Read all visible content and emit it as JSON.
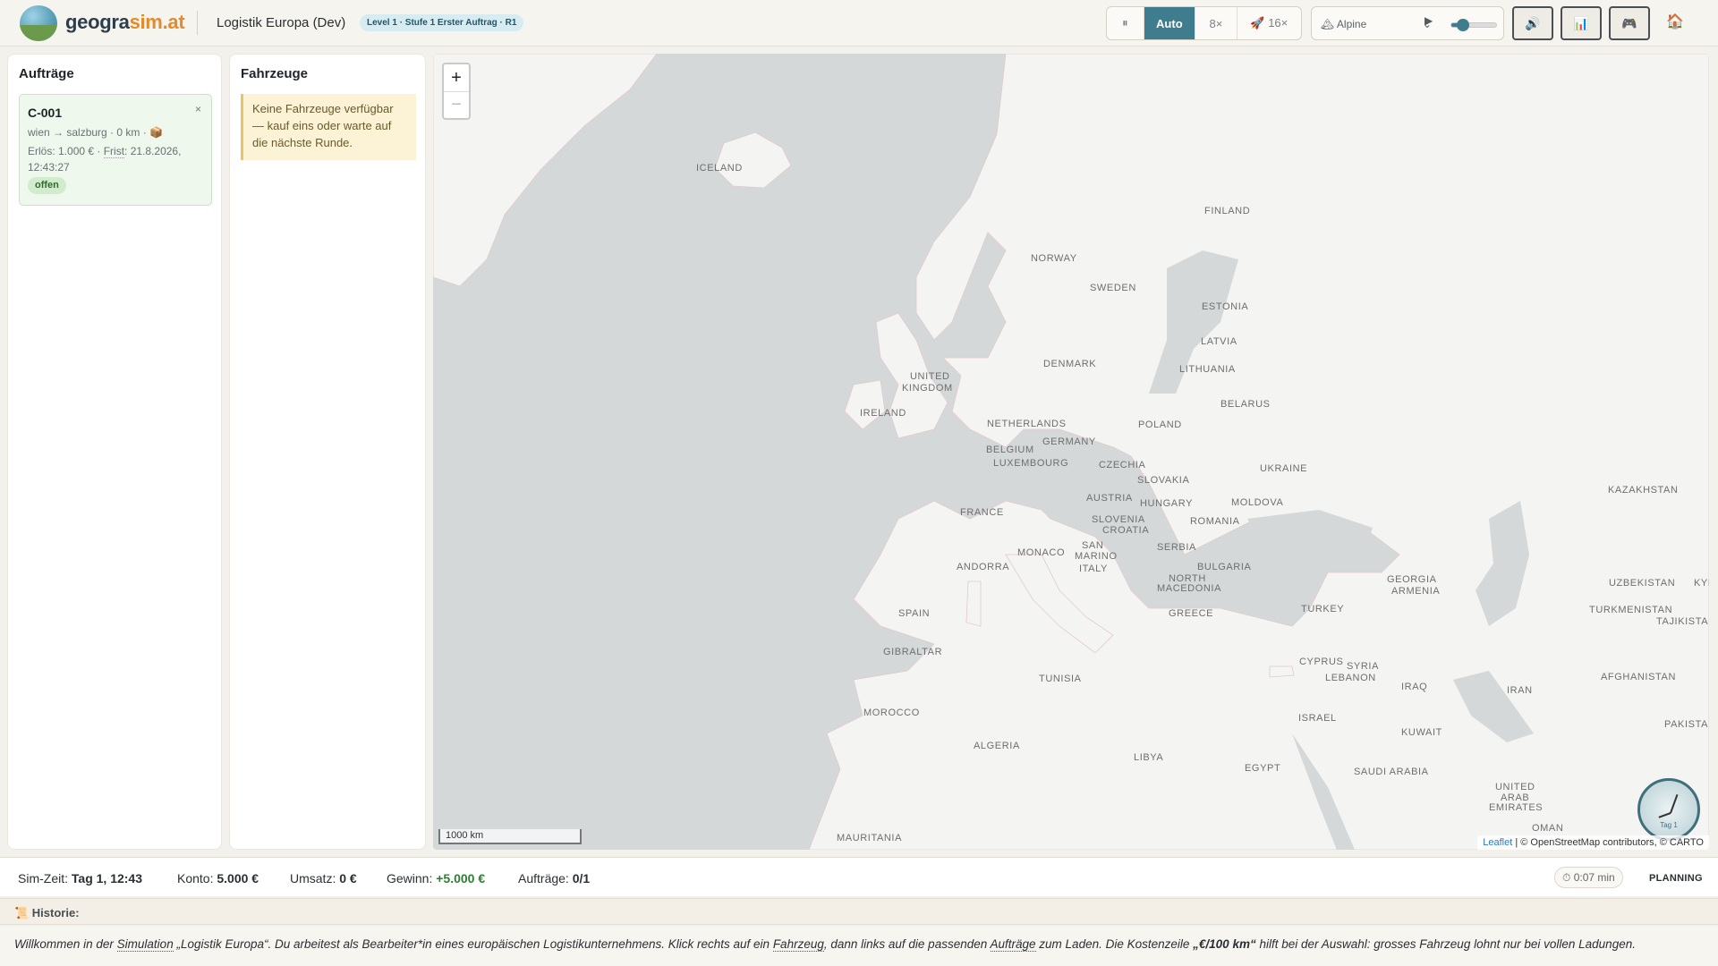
{
  "header": {
    "brand_main": "geogra",
    "brand_accent": "sim.at",
    "game_title": "Logistik Europa (Dev)",
    "level_pill": "Level 1 · Stufe 1 Erster Auftrag · R1",
    "speed": {
      "pause_label": "⏸",
      "auto_label": "Auto",
      "x8_label": "8×",
      "x16_label": "🚀 16×",
      "active": "Auto"
    },
    "music": {
      "track_label": "🏔 Alpine",
      "chevron": "⌄",
      "play_label": "▶",
      "volume": 0.25
    },
    "sound_icon": "🔊",
    "stats_icon": "📊",
    "gamepad_icon": "🎮",
    "home_icon": "🏠"
  },
  "orders_panel": {
    "title": "Aufträge",
    "orders": [
      {
        "id": "C-001",
        "close": "×",
        "route": "wien → salzburg · 0 km · 📦",
        "revenue_prefix": "Erlös: 1.000 € · ",
        "deadline_label": "Frist",
        "deadline_value": ": 21.8.2026, 12:43:27",
        "status": "offen"
      }
    ]
  },
  "vehicles_panel": {
    "title": "Fahrzeuge",
    "empty_notice": "Keine Fahrzeuge verfügbar — kauf eins oder warte auf die nächste Runde."
  },
  "map": {
    "zoom_in": "+",
    "zoom_out": "−",
    "scale_label": "1000 km",
    "attribution_link": "Leaflet",
    "attribution_text": " | © OpenStreetMap contributors, © CARTO",
    "clock_day": "Tag 1",
    "country_labels": [
      "ICELAND",
      "FINLAND",
      "NORWAY",
      "SWEDEN",
      "ESTONIA",
      "LATVIA",
      "DENMARK",
      "LITHUANIA",
      "UNITED",
      "KINGDOM",
      "IRELAND",
      "NETHERLANDS",
      "BELARUS",
      "POLAND",
      "BELGIUM",
      "GERMANY",
      "LUXEMBOURG",
      "CZECHIA",
      "UKRAINE",
      "SLOVAKIA",
      "KAZAKHSTAN",
      "FRANCE",
      "AUSTRIA",
      "HUNGARY",
      "MOLDOVA",
      "SLOVENIA",
      "CROATIA",
      "ROMANIA",
      "SAN",
      "MARINO",
      "MONACO",
      "SERBIA",
      "ANDORRA",
      "ITALY",
      "BULGARIA",
      "NORTH",
      "MACEDONIA",
      "GEORGIA",
      "ARMENIA",
      "UZBEKISTAN",
      "SPAIN",
      "TURKEY",
      "TURKMENISTAN",
      "TAJIKISTAN",
      "GREECE",
      "GIBRALTAR",
      "CYPRUS",
      "SYRIA",
      "TUNISIA",
      "LEBANON",
      "AFGHANISTAN",
      "IRAQ",
      "IRAN",
      "MOROCCO",
      "ISRAEL",
      "KUWAIT",
      "PAKISTA",
      "ALGERIA",
      "LIBYA",
      "EGYPT",
      "SAUDI ARABIA",
      "UNITED",
      "ARAB",
      "EMIRATES",
      "OMAN",
      "MAURITANIA",
      "KYR"
    ]
  },
  "status": {
    "sim_time_label": "Sim-Zeit: ",
    "sim_time_value": "Tag 1, 12:43",
    "konto_label": "Konto: ",
    "konto_value": "5.000 €",
    "umsatz_label": "Umsatz: ",
    "umsatz_value": "0 €",
    "gewinn_label": "Gewinn: ",
    "gewinn_value": "+5.000 €",
    "auftraege_label": "Aufträge: ",
    "auftraege_value": "0/1",
    "timer": "⏱ 0:07 min",
    "phase": "PLANNING"
  },
  "history": {
    "label": "📜 Historie:"
  },
  "message": {
    "p1": "Willkommen in der ",
    "simulation": "Simulation",
    "p2": " „Logistik Europa“. Du arbeitest als Bearbeiter*in eines europäischen Logistikunternehmens. Klick rechts auf ein ",
    "fahrzeug": "Fahrzeug",
    "p3": ", dann links auf die passenden ",
    "auftraege": "Aufträge",
    "p4": " zum Laden. Die Kostenzeile ",
    "kosten": "„€/100 km“",
    "p5": " hilft bei der Auswahl: grosses Fahrzeug lohnt nur bei vollen Ladungen."
  },
  "colors": {
    "accent": "#3f7d8e",
    "brand_orange": "#e48a2b",
    "order_bg": "#eef8ec",
    "notice_bg": "#fcf3d7",
    "water": "#d4d8d9",
    "land": "#f4f4f2",
    "profit_green": "#2e7d32"
  }
}
